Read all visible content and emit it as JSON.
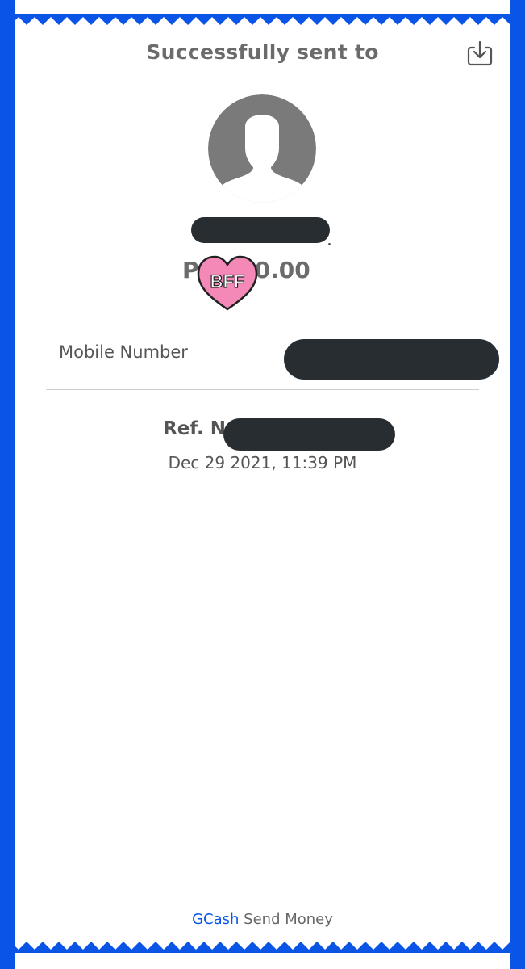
{
  "header": {
    "title": "Successfully sent to",
    "download_icon": "download-icon"
  },
  "recipient": {
    "name_suffix": "."
  },
  "transaction": {
    "amount": "P1,000.00",
    "sticker_text": "BFF",
    "mobile_label": "Mobile Number",
    "ref_label": "Ref. No.",
    "datetime": "Dec 29 2021, 11:39 PM"
  },
  "footer": {
    "brand": "GCash",
    "label": "Send Money"
  },
  "colors": {
    "background": "#0a55e6",
    "receipt": "#ffffff",
    "redaction": "#282d31",
    "sticker": "#f489b8"
  }
}
